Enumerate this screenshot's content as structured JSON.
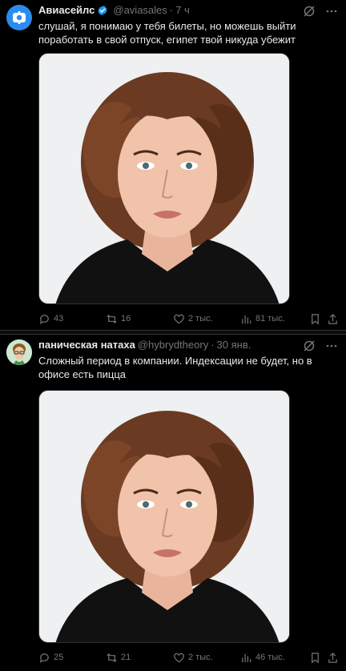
{
  "tweets": [
    {
      "author_name": "Авиасейлс",
      "verified": true,
      "handle": "@aviasales",
      "time": "7 ч",
      "text": "слушай, я понимаю у тебя билеты, но можешь выйти поработать в свой отпуск, египет твой никуда убежит",
      "avatar_icon": "aviasales-logo-icon",
      "media_icon": "portrait-photo-image",
      "stats": {
        "replies": "43",
        "retweets": "16",
        "likes": "2 тыс.",
        "views": "81 тыс."
      }
    },
    {
      "author_name": "паническая натаха",
      "verified": false,
      "handle": "@hybrydtheory",
      "time": "30 янв.",
      "text": "Сложный период в компании. Индексации не будет, но в офисе есть пицца",
      "avatar_icon": "cartoon-avatar-icon",
      "media_icon": "portrait-photo-image",
      "stats": {
        "replies": "25",
        "retweets": "21",
        "likes": "2 тыс.",
        "views": "46 тыс."
      }
    }
  ],
  "dot": "·",
  "colors": {
    "background": "#000000",
    "text": "#e7e9ea",
    "muted": "#71767b",
    "verified": "#1d9bf0",
    "separator": "#2f3336"
  }
}
